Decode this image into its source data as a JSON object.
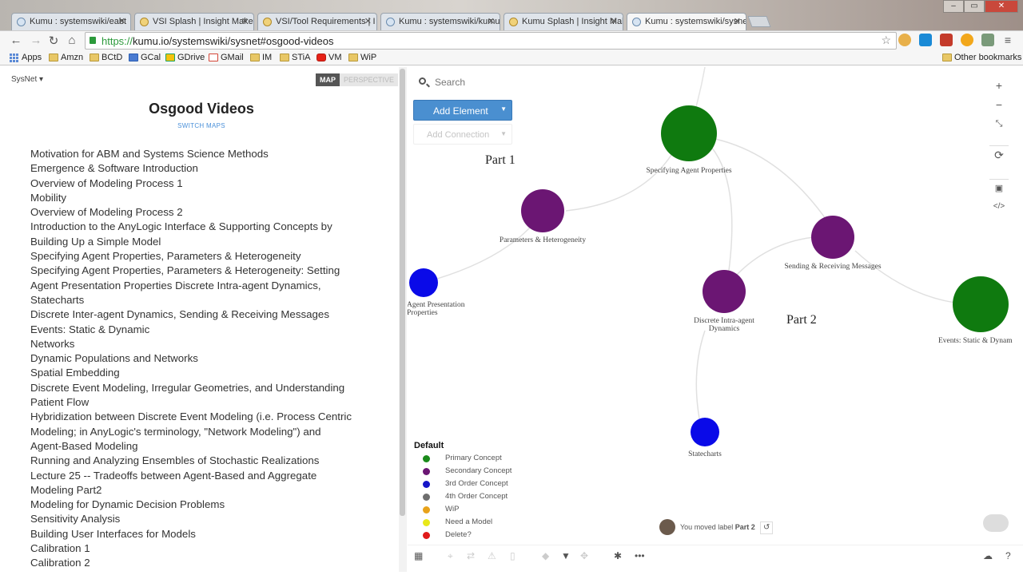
{
  "browser": {
    "tabs": [
      {
        "label": "Kumu : systemswiki/eabt",
        "icon": "globe-icon",
        "active": false
      },
      {
        "label": "VSI Splash | Insight Maker",
        "icon": "bulb-icon",
        "active": false
      },
      {
        "label": "VSI/Tool Requirements | I",
        "icon": "bulb-icon",
        "active": false
      },
      {
        "label": "Kumu : systemswiki/kumu",
        "icon": "globe-icon",
        "active": false
      },
      {
        "label": "Kumu Splash | Insight Mak",
        "icon": "bulb-icon",
        "active": false
      },
      {
        "label": "Kumu : systemswiki/sysne",
        "icon": "globe-icon",
        "active": true
      }
    ],
    "url_scheme": "https://",
    "url_rest": "kumu.io/systemswiki/sysnet#osgood-videos",
    "bookmarks": [
      "Apps",
      "Amzn",
      "BCtD",
      "GCal",
      "GDrive",
      "GMail",
      "IM",
      "STiA",
      "VM",
      "WiP"
    ],
    "other_bookmarks": "Other bookmarks"
  },
  "sidebar": {
    "project": "SysNet",
    "mode_map": "MAP",
    "mode_perspective": "PERSPECTIVE",
    "title": "Osgood Videos",
    "switch_maps": "SWITCH MAPS",
    "lines": [
      "Motivation for ABM and Systems Science Methods",
      "Emergence & Software Introduction",
      "Overview of Modeling Process 1",
      "Mobility",
      "Overview of Modeling Process 2",
      "Introduction to the AnyLogic Interface & Supporting Concepts by",
      "Building Up a Simple Model",
      "Specifying Agent Properties, Parameters & Heterogeneity",
      "Specifying Agent Properties, Parameters & Heterogeneity: Setting",
      "Agent Presentation Properties Discrete Intra-agent Dynamics,",
      "Statecharts",
      "Discrete Inter-agent Dynamics, Sending & Receiving Messages",
      "Events: Static & Dynamic",
      "Networks",
      "Dynamic Populations and Networks",
      "Spatial Embedding",
      "Discrete Event Modeling, Irregular Geometries, and Understanding",
      "Patient Flow",
      "Hybridization between Discrete Event Modeling (i.e. Process Centric",
      "Modeling; in AnyLogic's terminology, \"Network Modeling\") and",
      "Agent-Based Modeling",
      "Running and Analyzing Ensembles of Stochastic Realizations",
      "Lecture 25 -- Tradeoffs between Agent-Based and Aggregate",
      "Modeling Part2",
      "Modeling for Dynamic Decision Problems",
      "Sensitivity Analysis",
      "Building User Interfaces for Models",
      "Calibration 1",
      "Calibration 2"
    ]
  },
  "map": {
    "search_placeholder": "Search",
    "add_element": "Add Element",
    "add_connection": "Add Connection",
    "labels": {
      "part1": "Part 1",
      "part2": "Part 2"
    },
    "nodes": {
      "specifying": {
        "label": "Specifying Agent Properties",
        "color": "#0f7a0f"
      },
      "parameters": {
        "label": "Parameters & Heterogeneity",
        "color": "#6b1673"
      },
      "sending": {
        "label": "Sending & Receiving Messages",
        "color": "#6b1673"
      },
      "presentation_1": "Agent Presentation",
      "presentation_2": "Properties",
      "presentation_color": "#0a0ae8",
      "intra_1": "Discrete Intra-agent",
      "intra_2": "Dynamics",
      "intra_color": "#6b1673",
      "events": {
        "label": "Events: Static & Dynam",
        "color": "#0f7a0f"
      },
      "statecharts": {
        "label": "Statecharts",
        "color": "#0a0ae8"
      }
    },
    "legend": {
      "title": "Default",
      "items": [
        {
          "label": "Primary Concept",
          "color": "#1a8a1a"
        },
        {
          "label": "Secondary Concept",
          "color": "#6b1673"
        },
        {
          "label": "3rd Order Concept",
          "color": "#1515c8"
        },
        {
          "label": "4th Order Concept",
          "color": "#6e6e6e"
        },
        {
          "label": "WiP",
          "color": "#e8a21a"
        },
        {
          "label": "Need a Model",
          "color": "#e8e81a"
        },
        {
          "label": "Delete?",
          "color": "#e01a1a"
        }
      ]
    },
    "activity_prefix": "You moved label ",
    "activity_target": "Part 2"
  }
}
